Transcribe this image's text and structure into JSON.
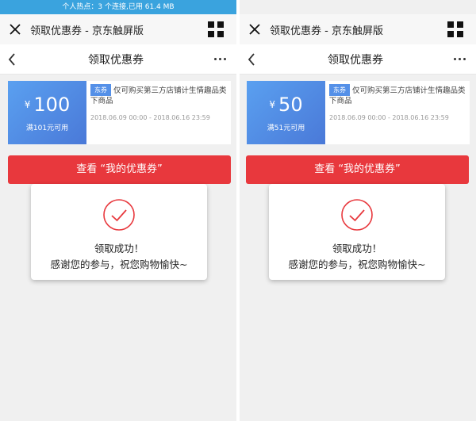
{
  "status_bar": {
    "text": "个人热点：3 个连接,已用 61.4 MB"
  },
  "colors": {
    "accent_red": "#e8383d",
    "coupon_blue": "#4a79d8",
    "status_blue": "#3aa3de"
  },
  "panels": [
    {
      "webview_title": "领取优惠券 - 京东触屏版",
      "nav_title": "领取优惠券",
      "coupon": {
        "currency": "¥",
        "amount": "100",
        "condition": "满101元可用",
        "tag": "东券",
        "description": "仅可购买第三方店铺计生情趣品类下商品",
        "validity": "2018.06.09 00:00 - 2018.06.16 23:59"
      },
      "button_label": "查看 “我的优惠券”",
      "modal": {
        "line1": "领取成功！",
        "line2": "感谢您的参与，祝您购物愉快~"
      }
    },
    {
      "webview_title": "领取优惠券 - 京东触屏版",
      "nav_title": "领取优惠券",
      "coupon": {
        "currency": "¥",
        "amount": "50",
        "condition": "满51元可用",
        "tag": "东券",
        "description": "仅可购买第三方店铺计生情趣品类下商品",
        "validity": "2018.06.09 00:00 - 2018.06.16 23:59"
      },
      "button_label": "查看 “我的优惠券”",
      "modal": {
        "line1": "领取成功！",
        "line2": "感谢您的参与，祝您购物愉快~"
      }
    }
  ]
}
